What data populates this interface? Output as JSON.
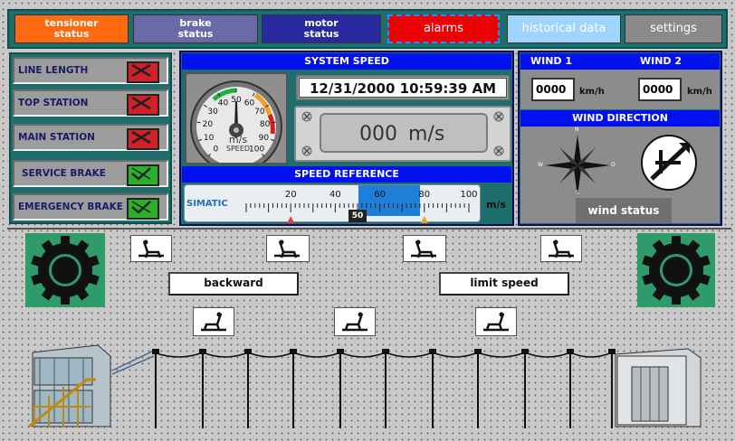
{
  "nav": {
    "tensioner": "tensioner\nstatus",
    "brake": "brake\nstatus",
    "motor": "motor\nstatus",
    "alarms": "alarms",
    "historical": "historical data",
    "settings": "settings",
    "colors": {
      "tensioner": "#ff6a10",
      "brake": "#6a6aa8",
      "motor": "#2a2aa0",
      "alarms": "#ee0000",
      "historical": "#9fd4ff",
      "settings": "#8a8a8a"
    }
  },
  "status": [
    {
      "label": "LINE LENGTH",
      "state": "fault"
    },
    {
      "label": "TOP STATION",
      "state": "fault"
    },
    {
      "label": "MAIN STATION",
      "state": "fault"
    },
    {
      "label": "SERVICE BRAKE",
      "state": "ok"
    },
    {
      "label": "EMERGENCY BRAKE",
      "state": "ok"
    }
  ],
  "speed": {
    "title": "SYSTEM SPEED",
    "datetime": "12/31/2000 10:59:39 AM",
    "value": "000",
    "unit": "m/s",
    "gauge_unit": "m/s",
    "gauge_label": "SPEED",
    "gauge_ticks": [
      "0",
      "10",
      "20",
      "30",
      "40",
      "50",
      "60",
      "70",
      "80",
      "90",
      "100"
    ]
  },
  "reference": {
    "title": "SPEED REFERENCE",
    "brand": "SIMATIC",
    "ticks": [
      "20",
      "40",
      "60",
      "80",
      "100"
    ],
    "value": "50",
    "unit": "m/s"
  },
  "wind": {
    "w1": "WIND 1",
    "w2": "WIND 2",
    "v1": "0000",
    "v2": "0000",
    "unit": "km/h",
    "direction_title": "WIND DIRECTION",
    "compass": [
      "N",
      "W",
      "O",
      "S"
    ],
    "status_btn": "wind status"
  },
  "controls": {
    "backward": "backward",
    "limit": "limit speed"
  }
}
